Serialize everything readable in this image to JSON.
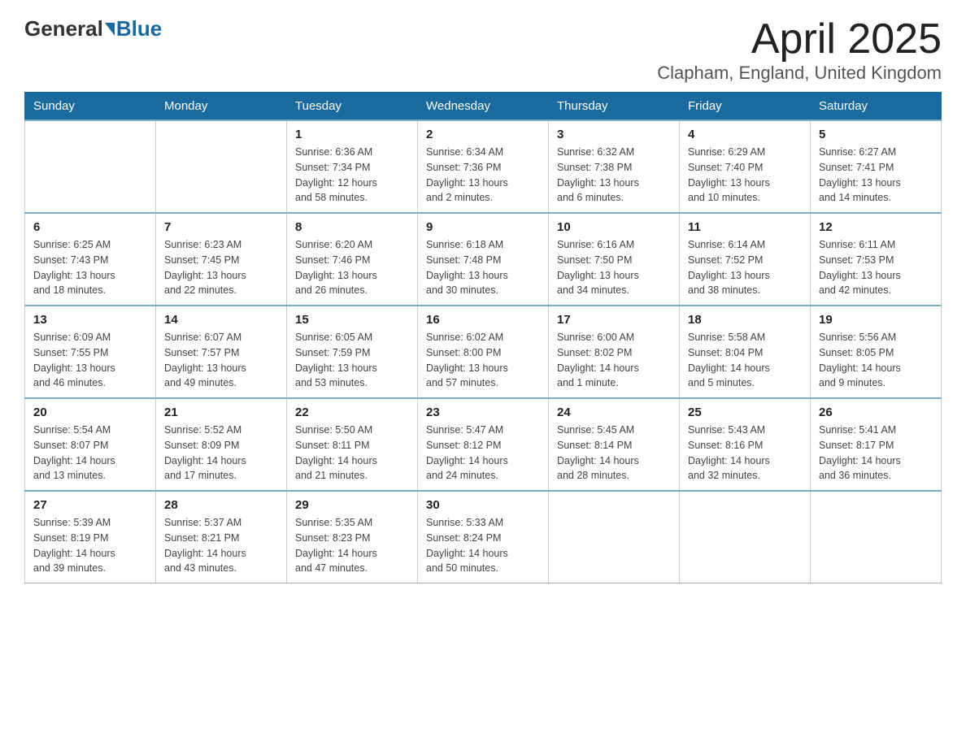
{
  "header": {
    "logo_general": "General",
    "logo_blue": "Blue",
    "title": "April 2025",
    "subtitle": "Clapham, England, United Kingdom"
  },
  "calendar": {
    "headers": [
      "Sunday",
      "Monday",
      "Tuesday",
      "Wednesday",
      "Thursday",
      "Friday",
      "Saturday"
    ],
    "weeks": [
      [
        {
          "day": "",
          "info": ""
        },
        {
          "day": "",
          "info": ""
        },
        {
          "day": "1",
          "info": "Sunrise: 6:36 AM\nSunset: 7:34 PM\nDaylight: 12 hours\nand 58 minutes."
        },
        {
          "day": "2",
          "info": "Sunrise: 6:34 AM\nSunset: 7:36 PM\nDaylight: 13 hours\nand 2 minutes."
        },
        {
          "day": "3",
          "info": "Sunrise: 6:32 AM\nSunset: 7:38 PM\nDaylight: 13 hours\nand 6 minutes."
        },
        {
          "day": "4",
          "info": "Sunrise: 6:29 AM\nSunset: 7:40 PM\nDaylight: 13 hours\nand 10 minutes."
        },
        {
          "day": "5",
          "info": "Sunrise: 6:27 AM\nSunset: 7:41 PM\nDaylight: 13 hours\nand 14 minutes."
        }
      ],
      [
        {
          "day": "6",
          "info": "Sunrise: 6:25 AM\nSunset: 7:43 PM\nDaylight: 13 hours\nand 18 minutes."
        },
        {
          "day": "7",
          "info": "Sunrise: 6:23 AM\nSunset: 7:45 PM\nDaylight: 13 hours\nand 22 minutes."
        },
        {
          "day": "8",
          "info": "Sunrise: 6:20 AM\nSunset: 7:46 PM\nDaylight: 13 hours\nand 26 minutes."
        },
        {
          "day": "9",
          "info": "Sunrise: 6:18 AM\nSunset: 7:48 PM\nDaylight: 13 hours\nand 30 minutes."
        },
        {
          "day": "10",
          "info": "Sunrise: 6:16 AM\nSunset: 7:50 PM\nDaylight: 13 hours\nand 34 minutes."
        },
        {
          "day": "11",
          "info": "Sunrise: 6:14 AM\nSunset: 7:52 PM\nDaylight: 13 hours\nand 38 minutes."
        },
        {
          "day": "12",
          "info": "Sunrise: 6:11 AM\nSunset: 7:53 PM\nDaylight: 13 hours\nand 42 minutes."
        }
      ],
      [
        {
          "day": "13",
          "info": "Sunrise: 6:09 AM\nSunset: 7:55 PM\nDaylight: 13 hours\nand 46 minutes."
        },
        {
          "day": "14",
          "info": "Sunrise: 6:07 AM\nSunset: 7:57 PM\nDaylight: 13 hours\nand 49 minutes."
        },
        {
          "day": "15",
          "info": "Sunrise: 6:05 AM\nSunset: 7:59 PM\nDaylight: 13 hours\nand 53 minutes."
        },
        {
          "day": "16",
          "info": "Sunrise: 6:02 AM\nSunset: 8:00 PM\nDaylight: 13 hours\nand 57 minutes."
        },
        {
          "day": "17",
          "info": "Sunrise: 6:00 AM\nSunset: 8:02 PM\nDaylight: 14 hours\nand 1 minute."
        },
        {
          "day": "18",
          "info": "Sunrise: 5:58 AM\nSunset: 8:04 PM\nDaylight: 14 hours\nand 5 minutes."
        },
        {
          "day": "19",
          "info": "Sunrise: 5:56 AM\nSunset: 8:05 PM\nDaylight: 14 hours\nand 9 minutes."
        }
      ],
      [
        {
          "day": "20",
          "info": "Sunrise: 5:54 AM\nSunset: 8:07 PM\nDaylight: 14 hours\nand 13 minutes."
        },
        {
          "day": "21",
          "info": "Sunrise: 5:52 AM\nSunset: 8:09 PM\nDaylight: 14 hours\nand 17 minutes."
        },
        {
          "day": "22",
          "info": "Sunrise: 5:50 AM\nSunset: 8:11 PM\nDaylight: 14 hours\nand 21 minutes."
        },
        {
          "day": "23",
          "info": "Sunrise: 5:47 AM\nSunset: 8:12 PM\nDaylight: 14 hours\nand 24 minutes."
        },
        {
          "day": "24",
          "info": "Sunrise: 5:45 AM\nSunset: 8:14 PM\nDaylight: 14 hours\nand 28 minutes."
        },
        {
          "day": "25",
          "info": "Sunrise: 5:43 AM\nSunset: 8:16 PM\nDaylight: 14 hours\nand 32 minutes."
        },
        {
          "day": "26",
          "info": "Sunrise: 5:41 AM\nSunset: 8:17 PM\nDaylight: 14 hours\nand 36 minutes."
        }
      ],
      [
        {
          "day": "27",
          "info": "Sunrise: 5:39 AM\nSunset: 8:19 PM\nDaylight: 14 hours\nand 39 minutes."
        },
        {
          "day": "28",
          "info": "Sunrise: 5:37 AM\nSunset: 8:21 PM\nDaylight: 14 hours\nand 43 minutes."
        },
        {
          "day": "29",
          "info": "Sunrise: 5:35 AM\nSunset: 8:23 PM\nDaylight: 14 hours\nand 47 minutes."
        },
        {
          "day": "30",
          "info": "Sunrise: 5:33 AM\nSunset: 8:24 PM\nDaylight: 14 hours\nand 50 minutes."
        },
        {
          "day": "",
          "info": ""
        },
        {
          "day": "",
          "info": ""
        },
        {
          "day": "",
          "info": ""
        }
      ]
    ]
  }
}
